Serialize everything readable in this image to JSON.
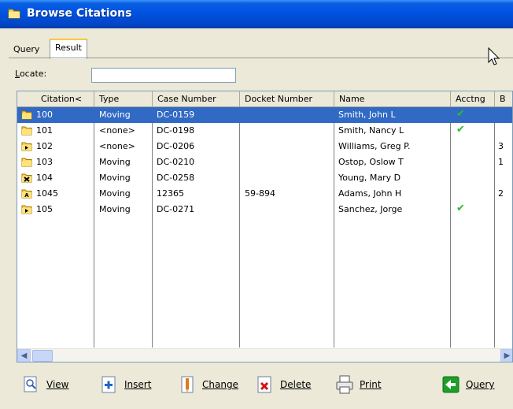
{
  "window": {
    "title": "Browse Citations"
  },
  "tabs": [
    {
      "label": "Query"
    },
    {
      "label": "Result"
    }
  ],
  "locate": {
    "label": "Locate:",
    "value": ""
  },
  "grid": {
    "columns": [
      "Citation<",
      "Type",
      "Case Number",
      "Docket Number",
      "Name",
      "Acctng",
      "B"
    ],
    "rows": [
      {
        "citation": "100",
        "type": "Moving",
        "case": "DC-0159",
        "docket": "",
        "name": "Smith, John L",
        "acctng": "✔",
        "b": "",
        "icon": "folder-icon",
        "selected": true
      },
      {
        "citation": "101",
        "type": "<none>",
        "case": "DC-0198",
        "docket": "",
        "name": "Smith, Nancy L",
        "acctng": "✔",
        "b": "",
        "icon": "folder-icon",
        "selected": false
      },
      {
        "citation": "102",
        "type": "<none>",
        "case": "DC-0206",
        "docket": "",
        "name": "Williams, Greg P.",
        "acctng": "",
        "b": "3",
        "icon": "folder-arrow-icon",
        "selected": false
      },
      {
        "citation": "103",
        "type": "Moving",
        "case": "DC-0210",
        "docket": "",
        "name": "Ostop, Oslow T",
        "acctng": "",
        "b": "1",
        "icon": "folder-icon",
        "selected": false
      },
      {
        "citation": "104",
        "type": "Moving",
        "case": "DC-0258",
        "docket": "",
        "name": "Young, Mary D",
        "acctng": "",
        "b": "",
        "icon": "folder-x-icon",
        "selected": false
      },
      {
        "citation": "1045",
        "type": "Moving",
        "case": "12365",
        "docket": "59-894",
        "name": "Adams, John H",
        "acctng": "",
        "b": "2",
        "icon": "folder-a-icon",
        "selected": false
      },
      {
        "citation": "105",
        "type": "Moving",
        "case": "DC-0271",
        "docket": "",
        "name": "Sanchez, Jorge",
        "acctng": "✔",
        "b": "",
        "icon": "folder-arrow-icon",
        "selected": false
      }
    ]
  },
  "toolbar": {
    "view": "View",
    "insert": "Insert",
    "change": "Change",
    "delete": "Delete",
    "print": "Print",
    "query": "Query"
  },
  "colors": {
    "title_bar": "#0054e3",
    "selection": "#316ac5",
    "check": "#2bbb2b",
    "window_bg": "#ece9d8"
  }
}
